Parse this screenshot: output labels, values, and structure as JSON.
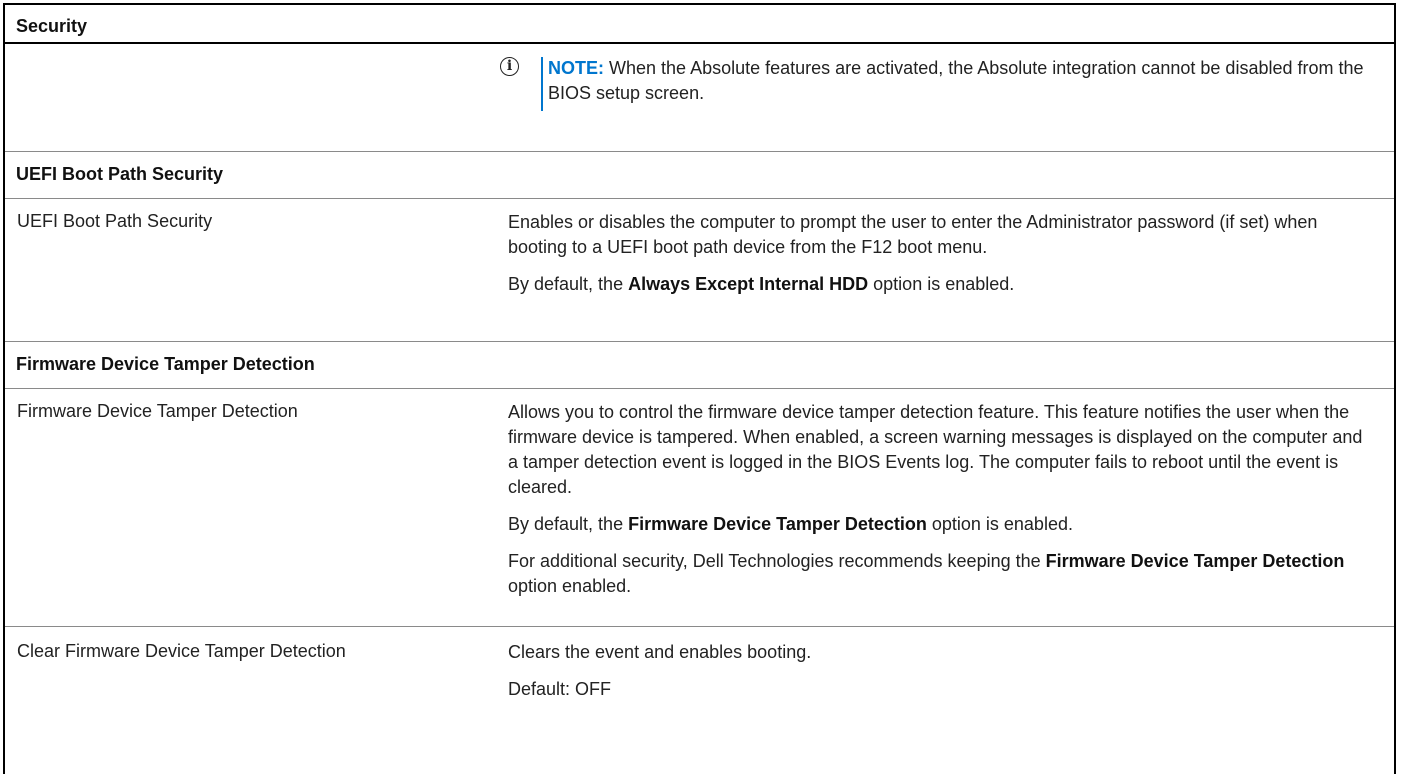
{
  "table": {
    "security_header": "Security",
    "note": {
      "label": "NOTE:",
      "text": "When the Absolute features are activated, the Absolute integration cannot be disabled from the BIOS setup screen."
    },
    "uefi_section": {
      "header": "UEFI Boot Path Security",
      "option": "UEFI Boot Path Security",
      "desc1": "Enables or disables the computer to prompt the user to enter the Administrator password (if set) when booting to a UEFI boot path device from the F12 boot menu.",
      "default_pre": "By default, the ",
      "default_bold": "Always Except Internal HDD",
      "default_post": " option is enabled."
    },
    "firmware_section": {
      "header": "Firmware Device Tamper Detection",
      "option": "Firmware Device Tamper Detection",
      "desc1": "Allows you to control the firmware device tamper detection feature. This feature notifies the user when the firmware device is tampered. When enabled, a screen warning messages is displayed on the computer and a tamper detection event is logged in the BIOS Events log. The computer fails to reboot until the event is cleared.",
      "default_pre": "By default, the ",
      "default_bold": "Firmware Device Tamper Detection",
      "default_post": " option is enabled.",
      "rec_pre": "For additional security, Dell Technologies recommends keeping the ",
      "rec_bold": "Firmware Device Tamper Detection",
      "rec_post": " option enabled."
    },
    "clear_row": {
      "option": "Clear Firmware Device Tamper Detection",
      "desc1": "Clears the event and enables booting.",
      "default": "Default: OFF"
    }
  },
  "colors": {
    "note_accent": "#0076ce",
    "border": "#000000",
    "row_separator": "#8a8a8a"
  },
  "icons": {
    "note": "info-circle-icon"
  }
}
